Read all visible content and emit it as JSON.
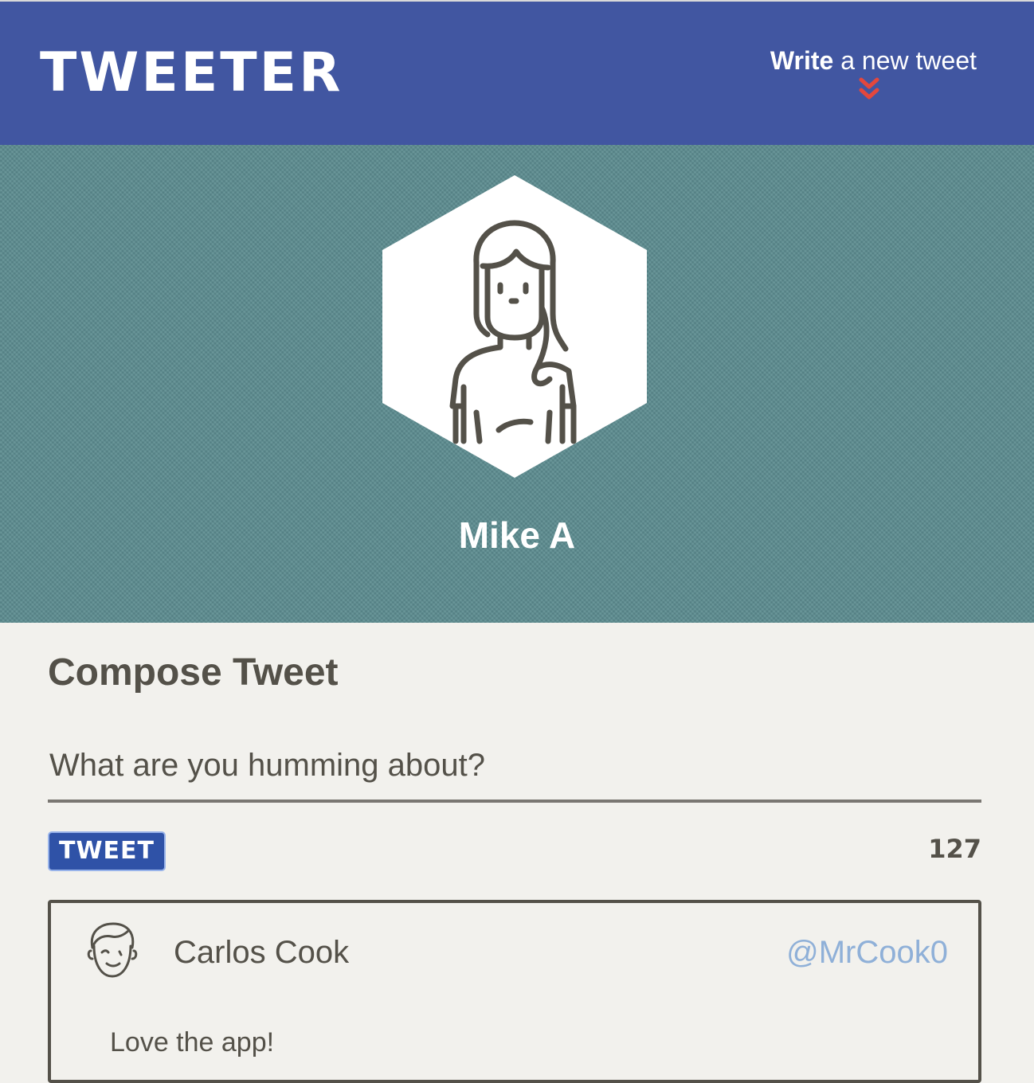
{
  "header": {
    "logo": "TWEETER",
    "write_bold": "Write",
    "write_rest": " a new tweet",
    "chevron_icon": "double-chevron-down-icon",
    "background_color": "#4156a1",
    "chevron_color": "#e4473d"
  },
  "profile": {
    "name": "Mike A",
    "avatar_icon": "woman-avatar-icon",
    "background_color": "#5c8c90"
  },
  "compose": {
    "title": "Compose Tweet",
    "placeholder": "What are you humming about?",
    "submit_label": "TWEET",
    "char_count": "127"
  },
  "tweets": [
    {
      "name": "Carlos Cook",
      "handle": "@MrCook0",
      "text": "Love the app!",
      "avatar_icon": "man-avatar-icon"
    }
  ]
}
